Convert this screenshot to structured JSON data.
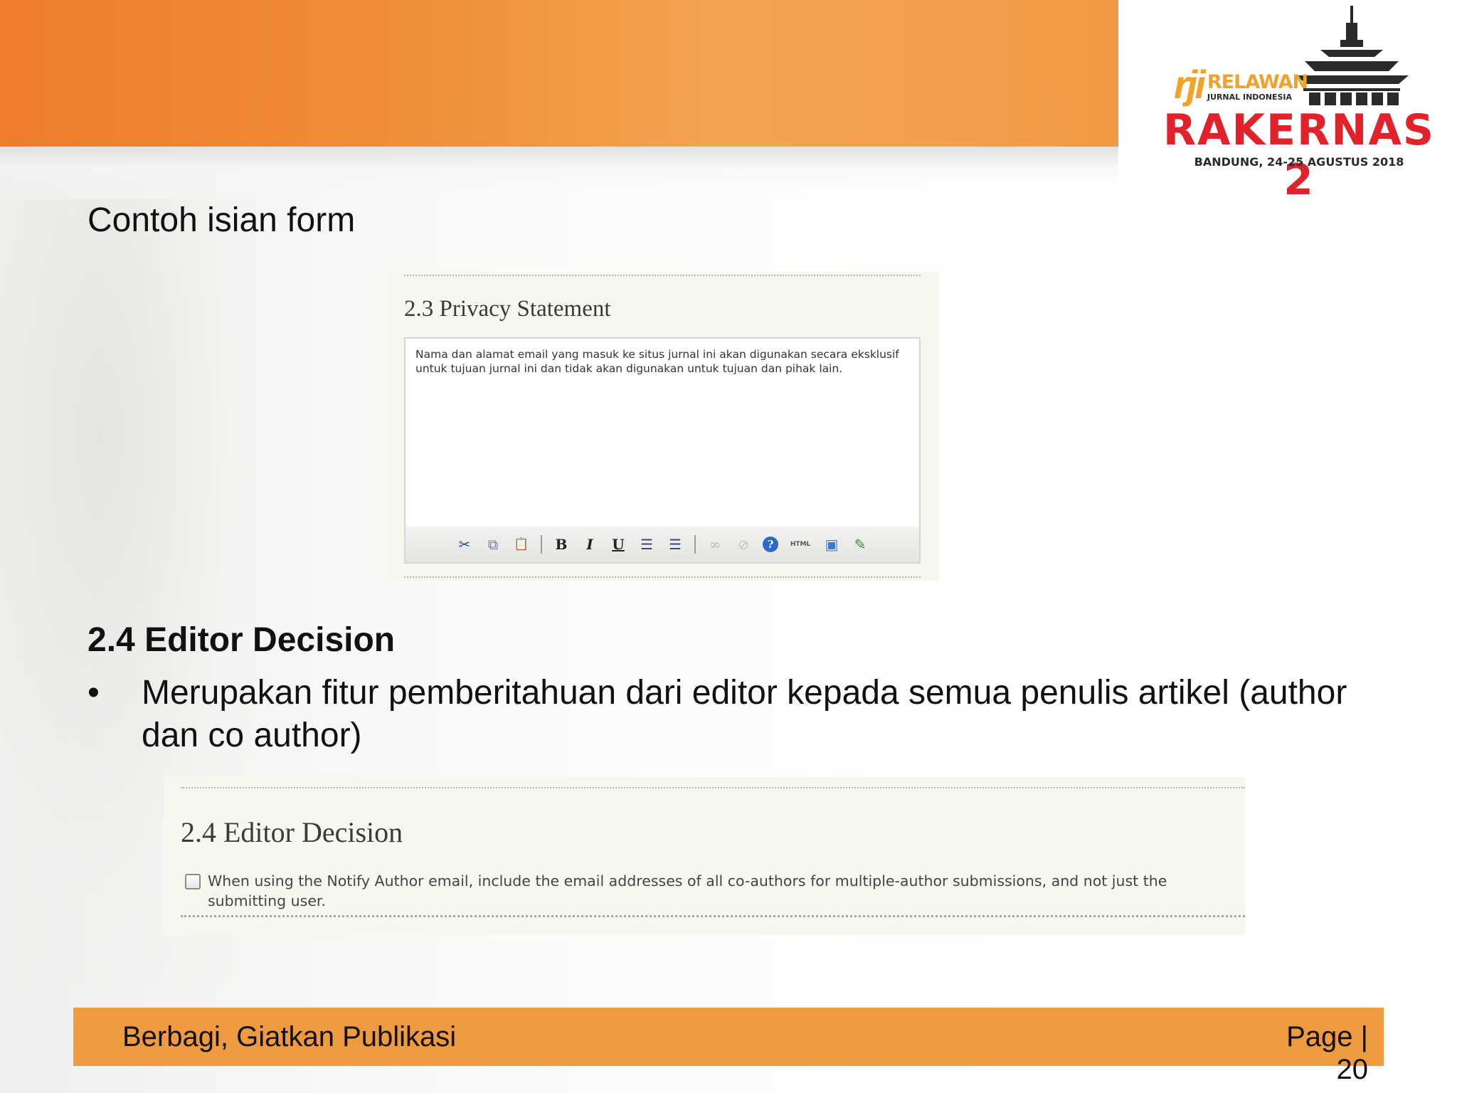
{
  "header": {
    "logo": {
      "rji_mark": "rji",
      "rji_name": "RELAWAN",
      "rji_subtitle": "JURNAL INDONESIA",
      "event_name": "RAKERNAS 2",
      "event_date": "BANDUNG, 24-25 AGUSTUS 2018",
      "accent_color": "#e2222a",
      "rji_color": "#f0a22a"
    },
    "band_color": "#ee7d2c"
  },
  "slide": {
    "subtitle": "Contoh isian form",
    "section_heading": "2.4 Editor Decision",
    "bullet_symbol": "•",
    "bullet_text": "Merupakan fitur pemberitahuan dari editor kepada semua penulis artikel (author dan co author)"
  },
  "screenshot_privacy": {
    "title": "2.3 Privacy Statement",
    "editor_text": "Nama dan alamat email yang masuk ke situs jurnal ini akan digunakan secara eksklusif untuk tujuan jurnal ini dan tidak akan digunakan untuk tujuan dan pihak lain.",
    "toolbar": {
      "cut": "✂",
      "copy": "⧉",
      "paste": "📋",
      "bold": "B",
      "italic": "I",
      "underline": "U",
      "bullet_list": "☰",
      "numbered_list": "☰",
      "link": "∞",
      "unlink": "⊘",
      "help": "?",
      "html": "HTML",
      "fullscreen": "▣",
      "image": "✎"
    }
  },
  "screenshot_editor_decision": {
    "title": "2.4 Editor Decision",
    "checkbox_label": "When using the Notify Author email, include the email addresses of all co-authors for multiple-author submissions, and not just the submitting user.",
    "checked": false
  },
  "footer": {
    "tagline": "Berbagi, Giatkan Publikasi",
    "page_label": "Page | 20",
    "band_color": "#ee9a41"
  }
}
